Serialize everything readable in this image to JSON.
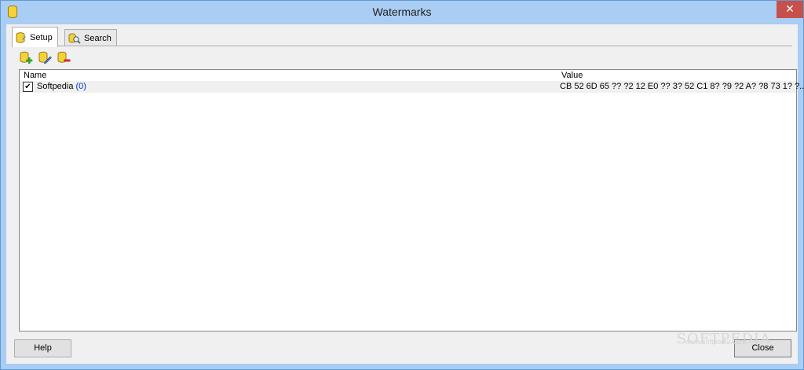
{
  "window": {
    "title": "Watermarks",
    "close_glyph": "✕"
  },
  "tabs": [
    {
      "label": "Setup",
      "icon": "database-icon"
    },
    {
      "label": "Search",
      "icon": "magnifier-icon"
    }
  ],
  "toolbar": [
    "add-icon",
    "edit-icon",
    "delete-icon"
  ],
  "list": {
    "columns": {
      "name": "Name",
      "value": "Value"
    },
    "rows": [
      {
        "checked": true,
        "name": "Softpedia",
        "count": "(0)",
        "value": "CB 52 6D 65 ?? ?2 12 E0 ?? 3? 52 C1 8? ?9 ?2 A? ?8 73 1? ?..."
      }
    ]
  },
  "buttons": {
    "help": "Help",
    "close": "Close"
  },
  "watermark": {
    "main": "SOFTPEDIA",
    "sub": "www.softpedia.com"
  },
  "colors": {
    "titlebar": "#a9cdf3",
    "close": "#c7504a",
    "link": "#0033cc"
  }
}
